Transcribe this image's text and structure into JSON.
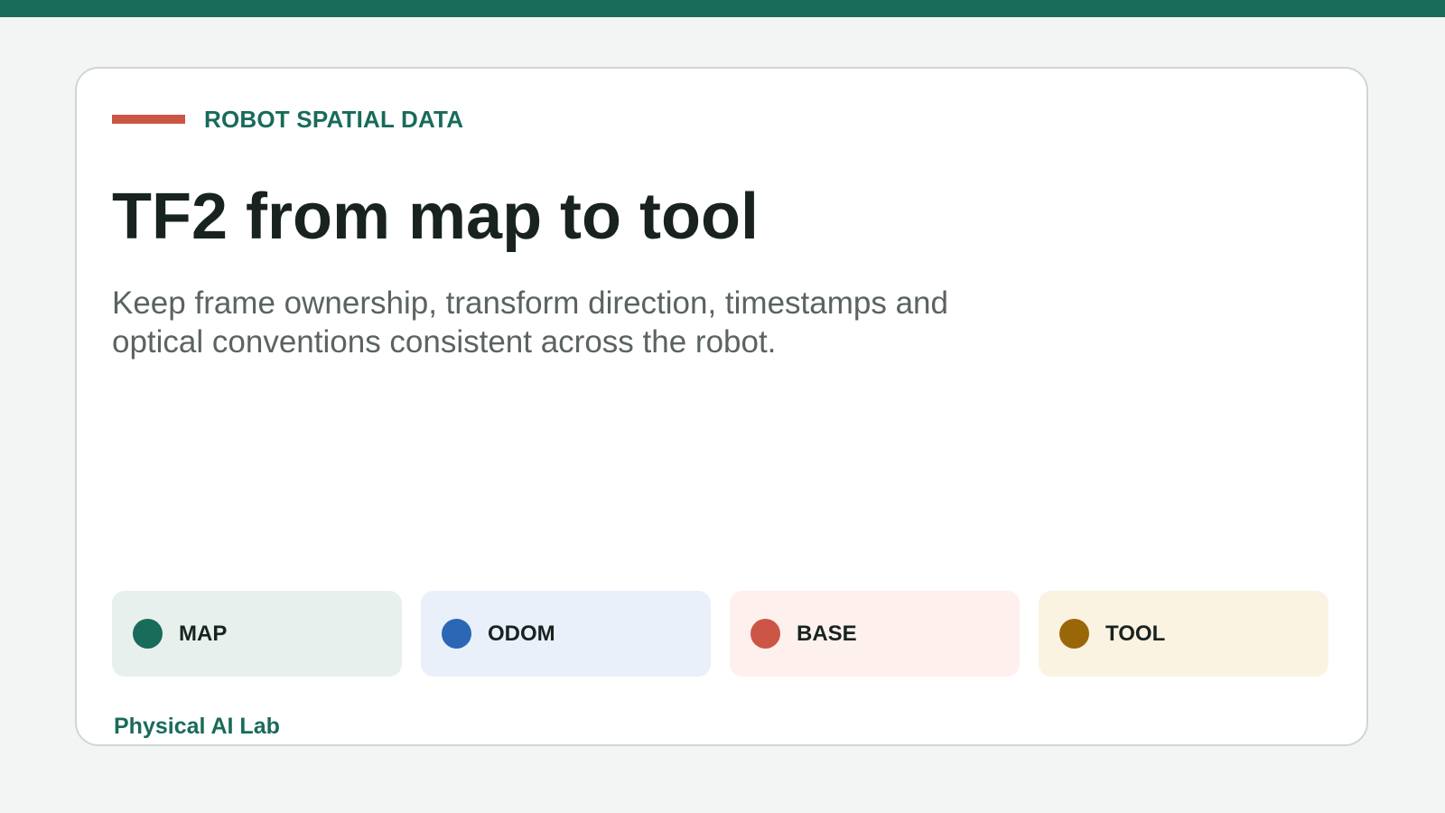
{
  "header": {
    "eyebrow": "ROBOT SPATIAL DATA",
    "title": "TF2 from map to tool",
    "subtitle": "Keep frame ownership, transform direction, timestamps and optical conventions consistent across the robot."
  },
  "frames": [
    {
      "label": "MAP",
      "dot_color": "#196b5a",
      "bg_color": "#e7f0ed"
    },
    {
      "label": "ODOM",
      "dot_color": "#2b67b4",
      "bg_color": "#e9f0fa"
    },
    {
      "label": "BASE",
      "dot_color": "#cc5645",
      "bg_color": "#fef0ed"
    },
    {
      "label": "TOOL",
      "dot_color": "#9a6708",
      "bg_color": "#fbf3e1"
    }
  ],
  "footer": {
    "brand": "Physical AI Lab"
  },
  "colors": {
    "accent_green": "#196b5a",
    "accent_red": "#cc5645",
    "page_bg": "#f3f5f4"
  }
}
